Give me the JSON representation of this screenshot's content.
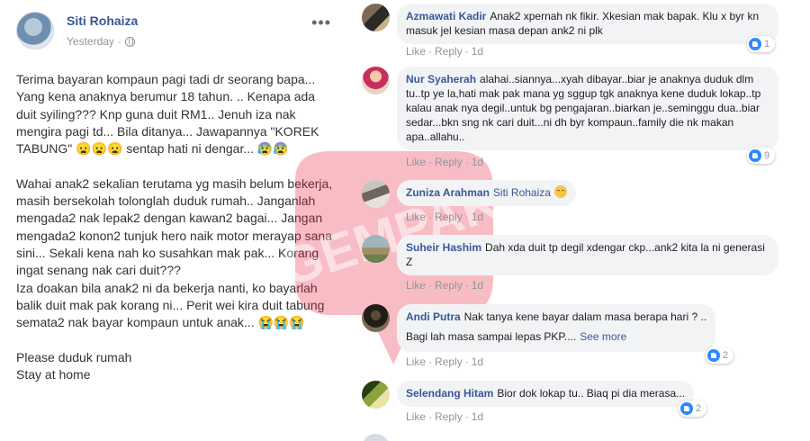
{
  "post": {
    "author": "Siti Rohaiza",
    "time": "Yesterday",
    "more": "•••",
    "body": "Terima bayaran kompaun pagi tadi dr seorang bapa... Yang kena anaknya berumur 18 tahun. .. Kenapa ada duit syiling??? Knp guna duit RM1.. Jenuh iza nak mengira pagi td... Bila ditanya... Jawapannya \"KOREK TABUNG\" 😦😦😦 sentap hati ni dengar... 😰😰\n\nWahai anak2 sekalian terutama yg masih belum bekerja, masih bersekolah tolonglah duduk rumah.. Janganlah mengada2 nak lepak2 dengan kawan2 bagai... Jangan mengada2 konon2 tunjuk hero naik motor merayap sana sini... Sekali kena nah ko susahkan mak pak... Korang ingat senang nak cari duit???\nIza doakan bila anak2 ni da bekerja nanti, ko bayarlah balik duit mak pak korang ni... Perit wei kira duit tabung semata2 nak bayar kompaun untuk anak... 😭😭😭\n\nPlease duduk rumah\nStay at home"
  },
  "watermark": {
    "text": "GEMPAK",
    "color": "#e8243c"
  },
  "actions": {
    "like": "Like",
    "reply": "Reply",
    "sep": "·"
  },
  "comments": [
    {
      "name": "Azmawati Kadir",
      "text": "Anak2 xpernah nk fikir. Xkesian mak bapak. Klu x byr kn masuk jel kesian masa depan ank2 ni plk",
      "time": "1d",
      "reactions": "1"
    },
    {
      "name": "Nur Syaherah",
      "text": "alahai..siannya...xyah dibayar..biar je anaknya duduk dlm tu..tp ye la,hati mak pak mana yg sggup tgk anaknya kene duduk lokap..tp kalau anak nya degil..untuk bg pengajaran..biarkan je..seminggu dua..biar sedar...bkn sng nk cari duit...ni dh byr kompaun..family die nk makan apa..allahu..",
      "time": "1d",
      "reactions": "9"
    },
    {
      "name": "Zuniza Arahman",
      "tag": "Siti Rohaiza",
      "text": "",
      "time": "1d",
      "reactions": ""
    },
    {
      "name": "Suheir Hashim",
      "text": "Dah xda duit tp degil xdengar ckp...ank2 kita la ni generasi Z",
      "time": "1d",
      "reactions": ""
    },
    {
      "name": "Andi Putra",
      "text": "Nak tanya kene bayar dalam masa berapa hari ? ..",
      "text2": "Bagi lah masa sampai lepas PKP....",
      "see_more": "See more",
      "time": "1d",
      "reactions": "2"
    },
    {
      "name": "Selendang Hitam",
      "text": "Bior dok lokap tu.. Biaq pi dia merasa...",
      "time": "1d",
      "reactions": "2"
    }
  ]
}
